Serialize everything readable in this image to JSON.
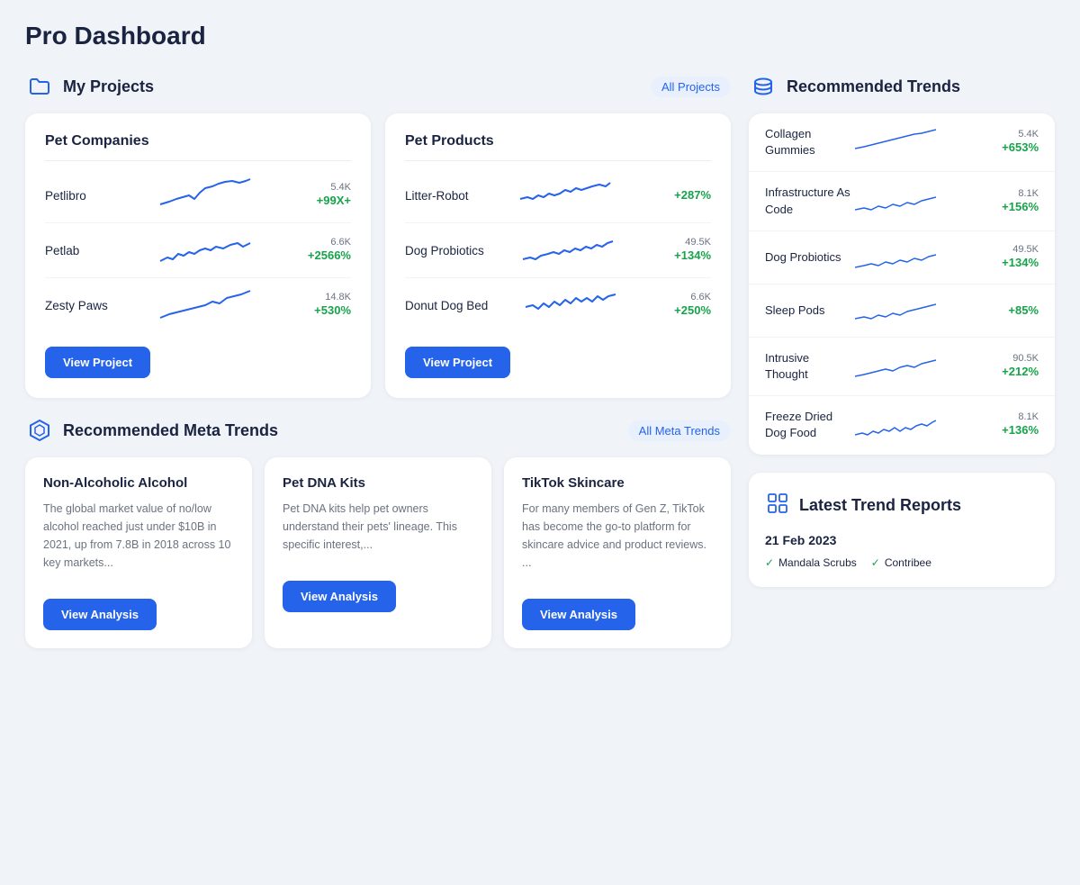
{
  "page": {
    "title": "Pro Dashboard"
  },
  "my_projects": {
    "label": "My Projects",
    "all_link": "All Projects",
    "cards": [
      {
        "title": "Pet Companies",
        "trends": [
          {
            "name": "Petlibro",
            "count": "5.4K",
            "pct": "+99X+"
          },
          {
            "name": "Petlab",
            "count": "6.6K",
            "pct": "+2566%"
          },
          {
            "name": "Zesty Paws",
            "count": "14.8K",
            "pct": "+530%"
          }
        ],
        "btn": "View Project"
      },
      {
        "title": "Pet Products",
        "trends": [
          {
            "name": "Litter-Robot",
            "count": "",
            "pct": "+287%"
          },
          {
            "name": "Dog Probiotics",
            "count": "49.5K",
            "pct": "+134%"
          },
          {
            "name": "Donut Dog Bed",
            "count": "6.6K",
            "pct": "+250%"
          }
        ],
        "btn": "View Project"
      }
    ]
  },
  "meta_trends": {
    "label": "Recommended Meta Trends",
    "all_link": "All Meta Trends",
    "cards": [
      {
        "title": "Non-Alcoholic Alcohol",
        "text": "The global market value of no/low alcohol reached just under $10B in 2021, up from 7.8B in 2018 across 10 key markets...",
        "btn": "View Analysis"
      },
      {
        "title": "Pet DNA Kits",
        "text": "Pet DNA kits help pet owners understand their pets' lineage. This specific interest,...",
        "btn": "View Analysis"
      },
      {
        "title": "TikTok Skincare",
        "text": "For many members of Gen Z, TikTok has become the go-to platform for skincare advice and product reviews. ...",
        "btn": "View Analysis"
      }
    ]
  },
  "recommended_trends": {
    "label": "Recommended Trends",
    "items": [
      {
        "name": "Collagen Gummies",
        "count": "5.4K",
        "pct": "+653%"
      },
      {
        "name": "Infrastructure As Code",
        "count": "8.1K",
        "pct": "+156%"
      },
      {
        "name": "Dog Probiotics",
        "count": "49.5K",
        "pct": "+134%"
      },
      {
        "name": "Sleep Pods",
        "count": "",
        "pct": "+85%"
      },
      {
        "name": "Intrusive Thought",
        "count": "90.5K",
        "pct": "+212%"
      },
      {
        "name": "Freeze Dried Dog Food",
        "count": "8.1K",
        "pct": "+136%"
      }
    ]
  },
  "latest_reports": {
    "label": "Latest Trend Reports",
    "date": "21 Feb 2023",
    "items": [
      "Mandala Scrubs",
      "Contribee"
    ]
  }
}
